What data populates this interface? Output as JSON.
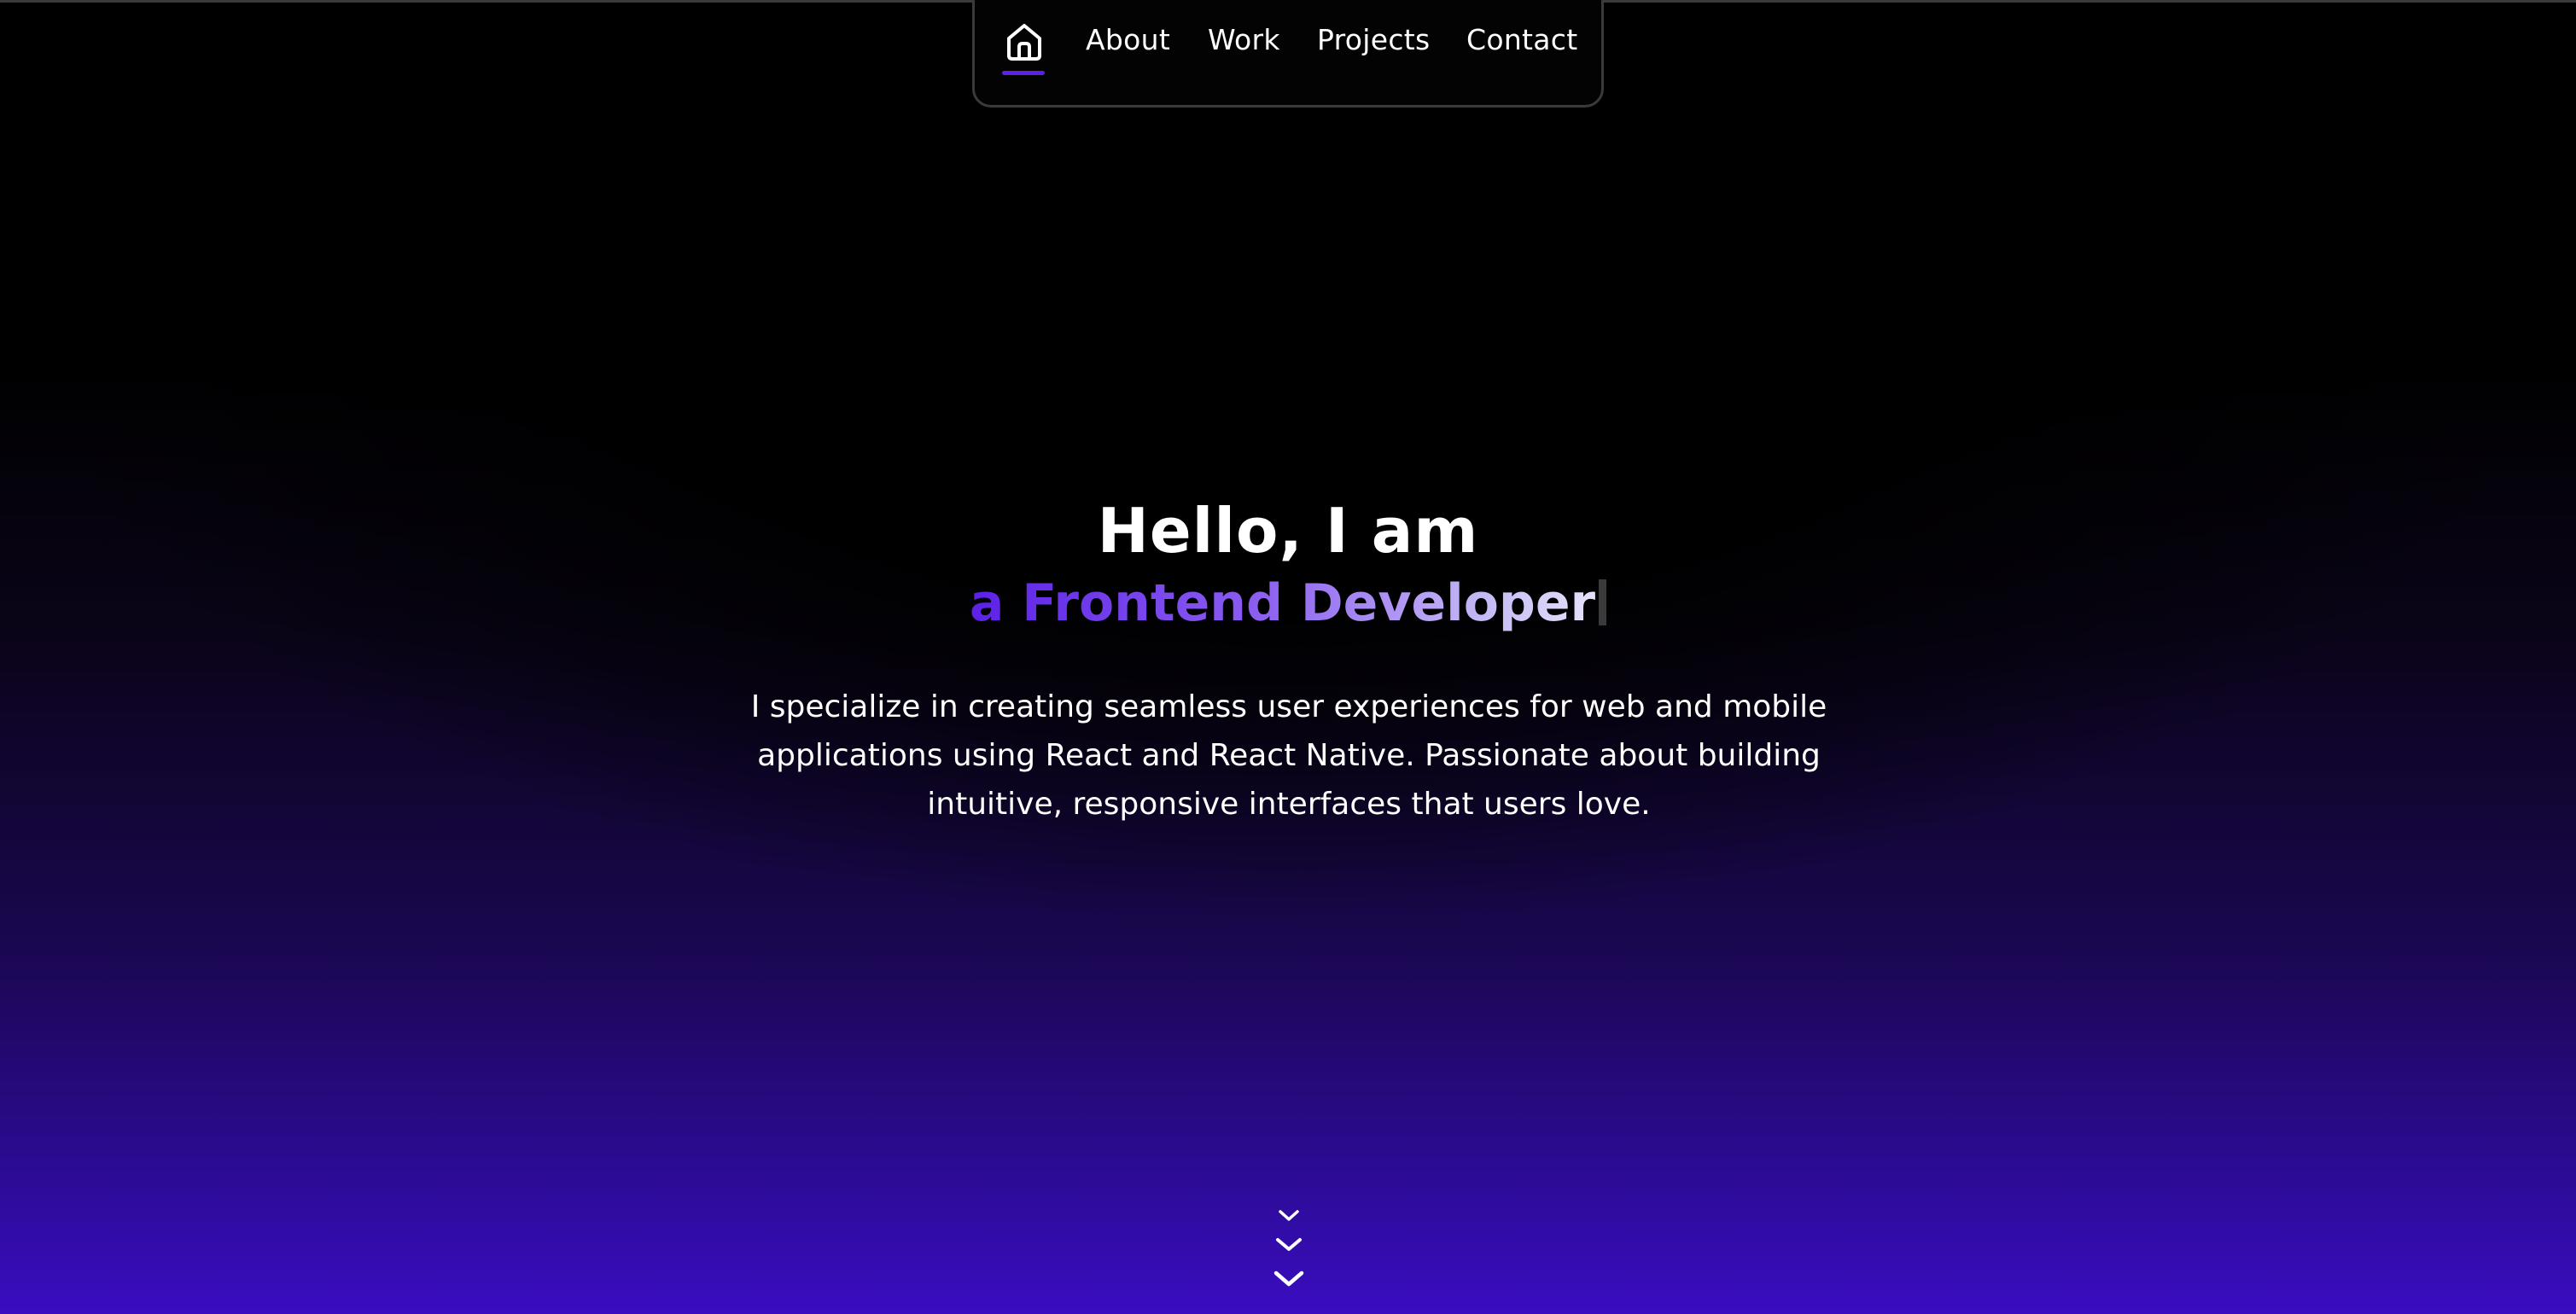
{
  "nav": {
    "home_icon": "home-icon",
    "items": [
      {
        "label": "About"
      },
      {
        "label": "Work"
      },
      {
        "label": "Projects"
      },
      {
        "label": "Contact"
      }
    ],
    "active_color": "#5b21e6"
  },
  "hero": {
    "greeting": "Hello, I am",
    "role": "a Frontend Developer",
    "description": "I specialize in creating seamless user experiences for web and mobile applications using React and React Native. Passionate about building intuitive, responsive interfaces that users love."
  },
  "scroll_indicator": {
    "icon": "chevron-down-icon"
  },
  "colors": {
    "background": "#000000",
    "accent": "#5b21e6",
    "gradient_bottom": "#3a0dc0"
  }
}
